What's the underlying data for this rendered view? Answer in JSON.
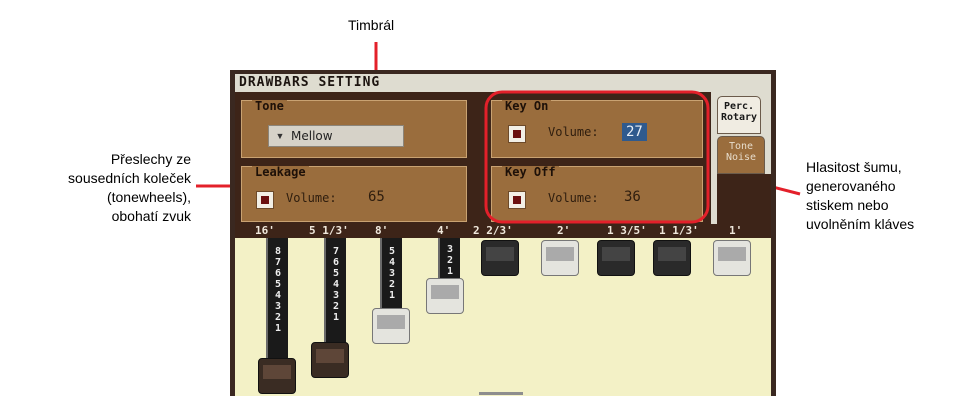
{
  "callouts": {
    "top": [
      "Timbrál"
    ],
    "left": [
      "Přeslechy ze",
      "sousedních koleček",
      "(tonewheels),",
      "obohatí zvuk"
    ],
    "right": [
      "Hlasitost šumu,",
      "generovaného",
      "stiskem nebo",
      "uvolněním kláves"
    ]
  },
  "screen": {
    "title": "DRAWBARS SETTING",
    "tone": {
      "label": "Tone",
      "selected": "Mellow"
    },
    "leakage": {
      "label": "Leakage",
      "volume_label": "Volume:",
      "volume_value": "65"
    },
    "key_on": {
      "label": "Key On",
      "volume_label": "Volume:",
      "volume_value": "27"
    },
    "key_off": {
      "label": "Key Off",
      "volume_label": "Volume:",
      "volume_value": "36"
    },
    "tabs": {
      "perc_rotary": [
        "Perc.",
        "Rotary"
      ],
      "tone_noise": [
        "Tone",
        "Noise"
      ]
    },
    "footages": [
      "16'",
      "5 1/3'",
      "8'",
      "4'",
      "2 2/3'",
      "2'",
      "1 3/5'",
      "1 1/3'",
      "1'"
    ],
    "drawbar_levels": [
      8,
      8,
      5,
      3,
      0,
      0,
      0,
      0,
      0
    ],
    "drawbar_scales": [
      [
        "8",
        "7",
        "6",
        "5",
        "4",
        "3",
        "2",
        "1"
      ],
      [
        "7",
        "6",
        "5",
        "4",
        "3",
        "2",
        "1"
      ],
      [
        "5",
        "4",
        "3",
        "2",
        "1"
      ],
      [
        "3",
        "2",
        "1"
      ]
    ]
  },
  "colors": {
    "highlight": "#e3202a",
    "panel": "#9a6d3d",
    "drawbar_bg": "#f3f1c6"
  }
}
